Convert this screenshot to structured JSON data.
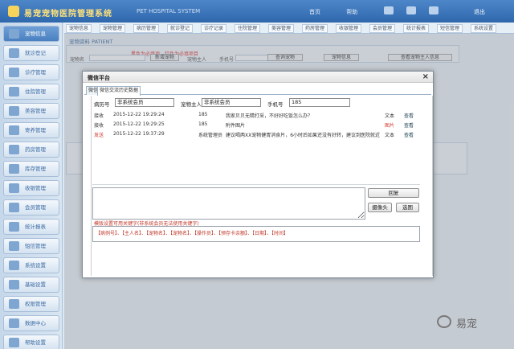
{
  "app": {
    "title": "易宠宠物医院管理系统",
    "subtitle": "PET HOSPITAL SYSTEM",
    "top_links": [
      "首页",
      "帮助"
    ],
    "user": "退出"
  },
  "sidebar": {
    "items": [
      {
        "label": "宠物信息",
        "active": true
      },
      {
        "label": "就诊登记"
      },
      {
        "label": "诊疗管理"
      },
      {
        "label": "住院管理"
      },
      {
        "label": "美容管理"
      },
      {
        "label": "寄养管理"
      },
      {
        "label": "药房管理"
      },
      {
        "label": "库存管理"
      },
      {
        "label": "收银管理"
      },
      {
        "label": "会员管理"
      },
      {
        "label": "统计报表"
      },
      {
        "label": "短信管理"
      },
      {
        "label": "系统设置"
      },
      {
        "label": "基础设置"
      },
      {
        "label": "权限管理"
      },
      {
        "label": "数据中心"
      },
      {
        "label": "帮助设置"
      }
    ]
  },
  "tabstrip": {
    "tabs": [
      "宠物信息",
      "宠物管理",
      "病历管理",
      "就诊登记",
      "诊疗记录",
      "住院管理",
      "美容管理",
      "药房管理",
      "收银管理",
      "会员管理",
      "统计报表",
      "短信管理",
      "系统设置"
    ]
  },
  "background": {
    "panel_title": "宠物资料 PATIENT",
    "hint": "黑色为必填项，红色为必填项目",
    "labels": [
      "宠物名",
      "宠物主人",
      "手机号"
    ],
    "buttons": [
      "新增宠物",
      "查询宠物",
      "宠物信息",
      "查看宠物主人信息"
    ]
  },
  "dialog": {
    "title": "微信平台",
    "close": "×",
    "tabs": [
      "微信",
      "微信交流历史数据"
    ],
    "fields": {
      "record_label": "病历号",
      "record_value": "非系统会员",
      "owner_label": "宠物主人",
      "owner_value": "非系统会员",
      "phone_label": "手机号",
      "phone_value": "185"
    },
    "messages": [
      {
        "dir": "接收",
        "time": "2015-12-22 19:29:24",
        "num": "185",
        "content": "我家贝贝无精打采，不好好吃饭怎么办？",
        "type": "文本",
        "type_color": "#333333",
        "action": "查看"
      },
      {
        "dir": "接收",
        "time": "2015-12-22 19:29:25",
        "num": "185",
        "content": "附件图片",
        "type": "图片",
        "type_color": "#d23b2f",
        "action": "查看"
      },
      {
        "dir": "发送",
        "time": "2015-12-22 19:37:29",
        "num": "系统管理员",
        "content": "建议喝两XX宠物健胃消食片，6小时后如果还没有好转，建议到医院就近就医看看",
        "type": "文本",
        "type_color": "#333333",
        "action": "查看"
      }
    ],
    "buttons": {
      "reply": "回复",
      "camera": "摄像头",
      "select": "选图"
    },
    "keywords": {
      "title": "模版设置可用关键字(非系统会员无法使用关键字)",
      "text": "【病例号】、【主人名】、【宠物名】、【宠物名】、【操作员】、【预存卡余额】、【日期】、【时间】"
    }
  },
  "watermark": {
    "text": "易宠"
  },
  "colors": {
    "topbar": "#2f67ac",
    "accent_red": "#c0392b",
    "sidebar_text": "#3b6aa3"
  }
}
